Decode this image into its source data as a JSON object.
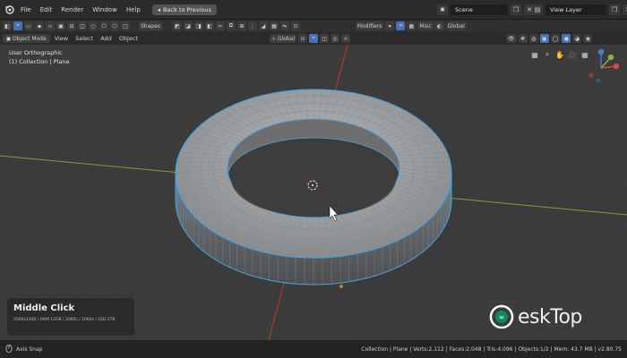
{
  "menu": {
    "items": [
      "File",
      "Edit",
      "Render",
      "Window",
      "Help"
    ],
    "back_button": "Back to Previous"
  },
  "top_right": {
    "scene": "Scene",
    "view_layer": "View Layer"
  },
  "tool_header": {
    "shapes_tab": "Shapes",
    "orientation": "Global",
    "modifiers_tab": "Modifiers",
    "misc_tab": "Misc",
    "global_label": "Global"
  },
  "viewport_header": {
    "mode": "Object Mode",
    "menus": [
      "View",
      "Select",
      "Add",
      "Object"
    ]
  },
  "viewport": {
    "view_name": "User Orthographic",
    "collection_info": "(1) Collection | Plane"
  },
  "keycast": {
    "key": "Middle Click",
    "info": "2560x1440 / RAM 12GB / 2060s / 1060s / SSD 2TB"
  },
  "watermark": {
    "text": "eskTop"
  },
  "statusbar": {
    "left": "Axis Snap",
    "right": "Collection | Plane | Verts:2,112 | Faces:2,048 | Tris:4,096 | Objects:1/2 | Mem: 43.7 MB | v2.80.75"
  },
  "colors": {
    "accent": "#4772b3",
    "wire": "#4aa3df",
    "x_axis": "#c0392b",
    "y_axis": "#9aa63b"
  }
}
